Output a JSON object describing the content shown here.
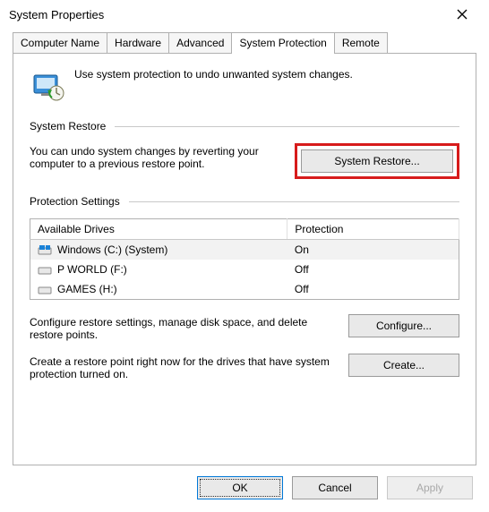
{
  "window": {
    "title": "System Properties"
  },
  "tabs": {
    "items": [
      {
        "label": "Computer Name"
      },
      {
        "label": "Hardware"
      },
      {
        "label": "Advanced"
      },
      {
        "label": "System Protection"
      },
      {
        "label": "Remote"
      }
    ],
    "activeIndex": 3
  },
  "intro": {
    "text": "Use system protection to undo unwanted system changes."
  },
  "restore": {
    "heading": "System Restore",
    "text": "You can undo system changes by reverting your computer to a previous restore point.",
    "button": "System Restore..."
  },
  "protection": {
    "heading": "Protection Settings",
    "columns": {
      "drive": "Available Drives",
      "status": "Protection"
    },
    "drives": [
      {
        "name": "Windows (C:) (System)",
        "status": "On",
        "iconColor": "#1a82d8"
      },
      {
        "name": "P WORLD (F:)",
        "status": "Off",
        "iconColor": "#c6c6c6"
      },
      {
        "name": "GAMES (H:)",
        "status": "Off",
        "iconColor": "#c6c6c6"
      }
    ],
    "configure": {
      "text": "Configure restore settings, manage disk space, and delete restore points.",
      "button": "Configure..."
    },
    "create": {
      "text": "Create a restore point right now for the drives that have system protection turned on.",
      "button": "Create..."
    }
  },
  "footer": {
    "ok": "OK",
    "cancel": "Cancel",
    "apply": "Apply"
  }
}
